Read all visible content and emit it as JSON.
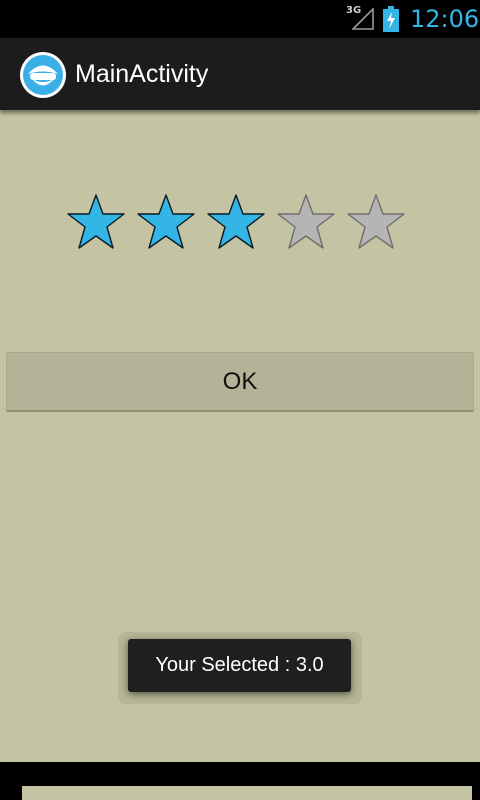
{
  "status_bar": {
    "network_label": "3G",
    "time": "12:06",
    "icons": [
      "signal-icon",
      "battery-charging-icon"
    ]
  },
  "action_bar": {
    "title": "MainActivity",
    "icon": "app-face-icon"
  },
  "rating": {
    "value": 3,
    "max": 5,
    "filled_color": "#33b5e5",
    "empty_color": "#b5b5b5"
  },
  "buttons": {
    "ok_label": "OK"
  },
  "toast": {
    "message": "Your Selected : 3.0"
  },
  "colors": {
    "background": "#c4c4a4",
    "accent": "#33b5e5",
    "action_bar": "#1c1c1c"
  }
}
